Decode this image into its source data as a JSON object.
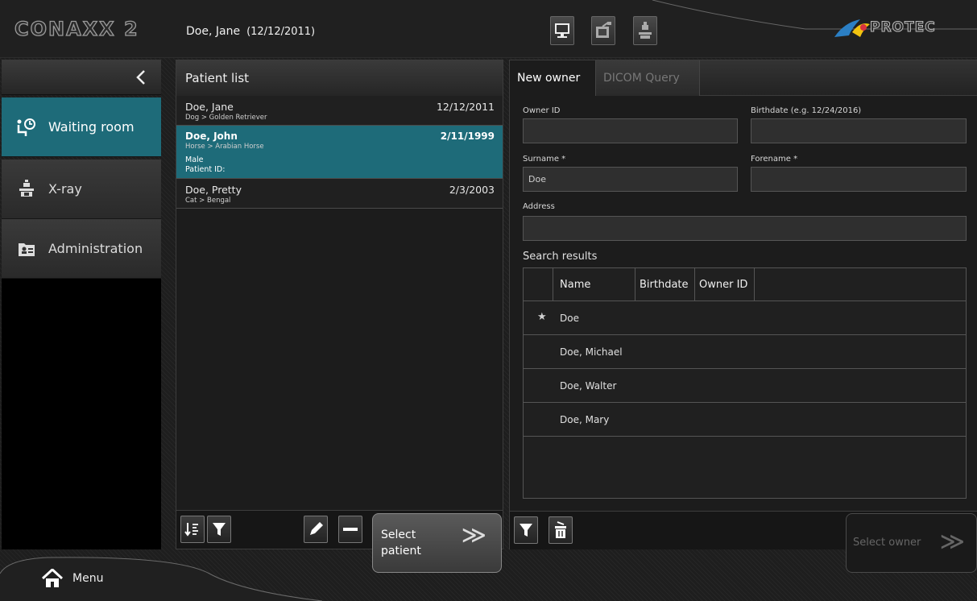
{
  "header": {
    "app_name": "CONAXX 2",
    "patient_name": "Doe, Jane",
    "patient_dob": "(12/12/2011)",
    "brand": "PROTEC"
  },
  "sidebar": {
    "items": [
      {
        "label": "Waiting room",
        "icon": "waiting-room-icon",
        "active": true
      },
      {
        "label": "X-ray",
        "icon": "xray-icon",
        "active": false
      },
      {
        "label": "Administration",
        "icon": "administration-icon",
        "active": false
      }
    ]
  },
  "patient_list": {
    "title": "Patient list",
    "rows": [
      {
        "name": "Doe, Jane",
        "date": "12/12/2011",
        "breed": "Dog > Golden Retriever"
      },
      {
        "name": "Doe, John",
        "date": "2/11/1999",
        "breed": "Horse > Arabian Horse",
        "sex": "Male",
        "patient_id": "Patient ID:"
      },
      {
        "name": "Doe, Pretty",
        "date": "2/3/2003",
        "breed": "Cat > Bengal"
      }
    ],
    "select_button": {
      "line1": "Select",
      "line2": "patient"
    }
  },
  "owner": {
    "tabs": [
      "New owner",
      "DICOM Query"
    ],
    "fields": {
      "owner_id_label": "Owner ID",
      "owner_id_value": "",
      "birthdate_label": "Birthdate  (e.g. 12/24/2016)",
      "birthdate_value": "",
      "surname_label": "Surname *",
      "surname_value": "Doe",
      "forename_label": "Forename *",
      "forename_value": "",
      "address_label": "Address",
      "address_value": ""
    },
    "search_results_label": "Search results",
    "columns": [
      "Name",
      "Birthdate",
      "Owner ID"
    ],
    "results": [
      {
        "name": "Doe",
        "starred": true
      },
      {
        "name": "Doe, Michael",
        "starred": false
      },
      {
        "name": "Doe, Walter",
        "starred": false
      },
      {
        "name": "Doe, Mary",
        "starred": false
      }
    ],
    "select_button": "Select owner"
  },
  "menu": {
    "label": "Menu"
  },
  "colors": {
    "accent": "#1e6b79",
    "background": "#1c1c1c"
  }
}
